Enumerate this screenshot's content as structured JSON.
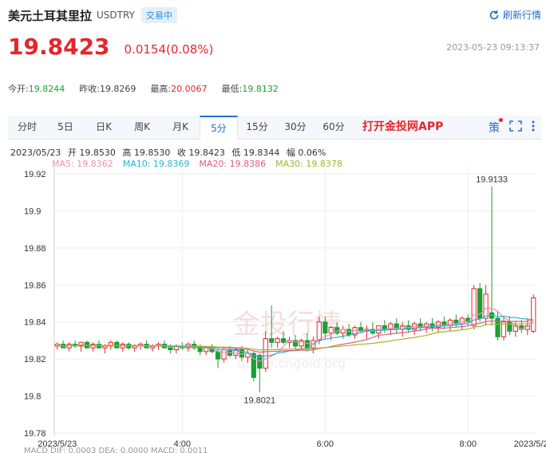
{
  "header": {
    "title": "美元土耳其里拉",
    "code": "USDTRY",
    "status": "交易中",
    "refresh_label": "刷新行情"
  },
  "quote": {
    "price": "19.8423",
    "change": "0.0154(0.08%)",
    "timestamp": "2023-05-23 09:13:37"
  },
  "stats": [
    {
      "label": "今开:",
      "value": "19.8244",
      "color": "green"
    },
    {
      "label": "昨收:",
      "value": "19.8269",
      "color": "gray"
    },
    {
      "label": "最高:",
      "value": "20.0067",
      "color": "red"
    },
    {
      "label": "最低:",
      "value": "19.8132",
      "color": "green"
    }
  ],
  "tabs": [
    "分时",
    "5日",
    "日K",
    "周K",
    "月K",
    "5分",
    "15分",
    "30分",
    "60分"
  ],
  "active_tab": "5分",
  "promo": "打开金投网APP",
  "toolbar_icons": [
    "策",
    "fullscreen-icon",
    "more-icon"
  ],
  "ohlc_bar": {
    "date": "2023/05/23",
    "open": "开 19.8530",
    "high": "高 19.8530",
    "close": "收 19.8423",
    "low": "低 19.8344",
    "amp": "幅 0.06%"
  },
  "ma": [
    {
      "label": "MA5: 19.8362",
      "color": "#f28cb1"
    },
    {
      "label": "MA10: 19.8369",
      "color": "#26b5d6"
    },
    {
      "label": "MA20: 19.8386",
      "color": "#e4588a"
    },
    {
      "label": "MA30: 19.8378",
      "color": "#9bbb2a"
    }
  ],
  "macd_text": "MACD  DIF: 0.0003   DEA: 0.0000   MACD: 0.0011",
  "chart_data": {
    "type": "candlestick",
    "y_ticks": [
      "19.92",
      "19.9",
      "19.88",
      "19.86",
      "19.84",
      "19.82",
      "19.8",
      "19.78"
    ],
    "ylim": [
      19.78,
      19.92
    ],
    "x_ticks": [
      {
        "label": "2023/5/23",
        "index": 0
      },
      {
        "label": "4:00",
        "index": 21
      },
      {
        "label": "6:00",
        "index": 45
      },
      {
        "label": "8:00",
        "index": 69
      },
      {
        "label": "2023/5/23",
        "index": 80
      }
    ],
    "annotations": [
      {
        "text": "19.9133",
        "index": 73,
        "value": 19.9133
      },
      {
        "text": "19.8021",
        "index": 34,
        "value": 19.8021
      }
    ],
    "watermark": "金投行情 quote.cngold.org",
    "candles": [
      [
        19.827,
        19.829,
        19.825,
        19.828
      ],
      [
        19.828,
        19.83,
        19.826,
        19.826
      ],
      [
        19.826,
        19.829,
        19.824,
        19.828
      ],
      [
        19.828,
        19.83,
        19.826,
        19.827
      ],
      [
        19.827,
        19.829,
        19.824,
        19.829
      ],
      [
        19.829,
        19.83,
        19.826,
        19.826
      ],
      [
        19.826,
        19.829,
        19.824,
        19.828
      ],
      [
        19.828,
        19.83,
        19.826,
        19.826
      ],
      [
        19.826,
        19.828,
        19.823,
        19.827
      ],
      [
        19.827,
        19.83,
        19.825,
        19.829
      ],
      [
        19.829,
        19.83,
        19.826,
        19.826
      ],
      [
        19.826,
        19.829,
        19.824,
        19.828
      ],
      [
        19.828,
        19.829,
        19.825,
        19.826
      ],
      [
        19.826,
        19.828,
        19.824,
        19.827
      ],
      [
        19.827,
        19.829,
        19.825,
        19.828
      ],
      [
        19.828,
        19.83,
        19.826,
        19.826
      ],
      [
        19.826,
        19.828,
        19.824,
        19.827
      ],
      [
        19.827,
        19.829,
        19.825,
        19.828
      ],
      [
        19.828,
        19.83,
        19.826,
        19.826
      ],
      [
        19.826,
        19.828,
        19.823,
        19.825
      ],
      [
        19.825,
        19.828,
        19.823,
        19.827
      ],
      [
        19.827,
        19.829,
        19.825,
        19.826
      ],
      [
        19.826,
        19.829,
        19.824,
        19.828
      ],
      [
        19.828,
        19.83,
        19.825,
        19.826
      ],
      [
        19.826,
        19.828,
        19.822,
        19.824
      ],
      [
        19.824,
        19.827,
        19.822,
        19.826
      ],
      [
        19.826,
        19.828,
        19.823,
        19.824
      ],
      [
        19.824,
        19.826,
        19.815,
        19.82
      ],
      [
        19.82,
        19.826,
        19.818,
        19.825
      ],
      [
        19.825,
        19.827,
        19.821,
        19.822
      ],
      [
        19.822,
        19.826,
        19.82,
        19.825
      ],
      [
        19.825,
        19.827,
        19.819,
        19.821
      ],
      [
        19.821,
        19.825,
        19.818,
        19.823
      ],
      [
        19.823,
        19.824,
        19.808,
        19.81
      ],
      [
        19.822,
        19.823,
        19.802,
        19.815
      ],
      [
        19.815,
        19.835,
        19.813,
        19.831
      ],
      [
        19.831,
        19.849,
        19.826,
        19.829
      ],
      [
        19.829,
        19.832,
        19.826,
        19.831
      ],
      [
        19.831,
        19.835,
        19.828,
        19.829
      ],
      [
        19.829,
        19.832,
        19.826,
        19.83
      ],
      [
        19.83,
        19.833,
        19.825,
        19.827
      ],
      [
        19.827,
        19.831,
        19.825,
        19.83
      ],
      [
        19.83,
        19.834,
        19.824,
        19.826
      ],
      [
        19.826,
        19.832,
        19.823,
        19.83
      ],
      [
        19.83,
        19.843,
        19.828,
        19.84
      ],
      [
        19.84,
        19.843,
        19.831,
        19.834
      ],
      [
        19.834,
        19.838,
        19.83,
        19.837
      ],
      [
        19.837,
        19.84,
        19.833,
        19.834
      ],
      [
        19.834,
        19.838,
        19.831,
        19.836
      ],
      [
        19.836,
        19.839,
        19.832,
        19.833
      ],
      [
        19.833,
        19.838,
        19.831,
        19.837
      ],
      [
        19.837,
        19.84,
        19.834,
        19.835
      ],
      [
        19.835,
        19.838,
        19.831,
        19.836
      ],
      [
        19.836,
        19.84,
        19.833,
        19.834
      ],
      [
        19.834,
        19.838,
        19.831,
        19.838
      ],
      [
        19.838,
        19.841,
        19.834,
        19.836
      ],
      [
        19.836,
        19.84,
        19.833,
        19.839
      ],
      [
        19.839,
        19.842,
        19.834,
        19.836
      ],
      [
        19.836,
        19.84,
        19.832,
        19.838
      ],
      [
        19.838,
        19.841,
        19.834,
        19.836
      ],
      [
        19.836,
        19.84,
        19.833,
        19.839
      ],
      [
        19.839,
        19.842,
        19.835,
        19.837
      ],
      [
        19.837,
        19.84,
        19.834,
        19.839
      ],
      [
        19.839,
        19.842,
        19.835,
        19.837
      ],
      [
        19.837,
        19.841,
        19.834,
        19.84
      ],
      [
        19.84,
        19.843,
        19.836,
        19.838
      ],
      [
        19.838,
        19.842,
        19.835,
        19.841
      ],
      [
        19.841,
        19.844,
        19.837,
        19.839
      ],
      [
        19.839,
        19.843,
        19.836,
        19.842
      ],
      [
        19.842,
        19.844,
        19.838,
        19.84
      ],
      [
        19.838,
        19.86,
        19.836,
        19.858
      ],
      [
        19.858,
        19.861,
        19.84,
        19.842
      ],
      [
        19.842,
        19.86,
        19.838,
        19.855
      ],
      [
        19.845,
        19.9133,
        19.838,
        19.842
      ],
      [
        19.842,
        19.846,
        19.83,
        19.832
      ],
      [
        19.832,
        19.843,
        19.83,
        19.84
      ],
      [
        19.84,
        19.843,
        19.833,
        19.835
      ],
      [
        19.835,
        19.84,
        19.832,
        19.838
      ],
      [
        19.838,
        19.841,
        19.834,
        19.836
      ],
      [
        19.836,
        19.842,
        19.833,
        19.838
      ],
      [
        19.835,
        19.855,
        19.834,
        19.853
      ]
    ]
  }
}
